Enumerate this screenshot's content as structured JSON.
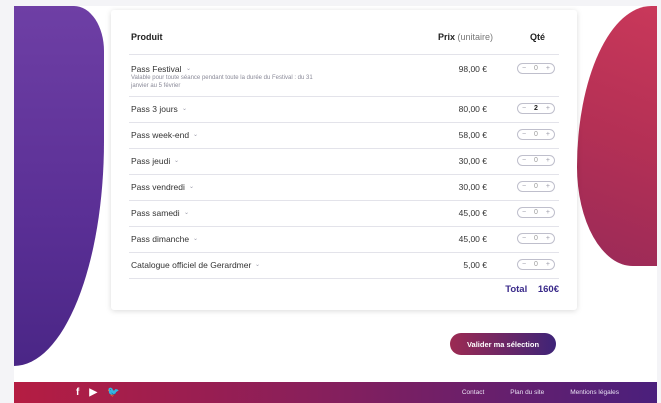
{
  "table": {
    "header_product": "Produit",
    "header_price": "Prix",
    "header_price_unit": "(unitaire)",
    "header_qty": "Qté"
  },
  "rows": [
    {
      "name": "Pass Festival",
      "desc": "Valable pour toute séance pendant toute la durée du Festival : du 31 janvier au 5 février",
      "price": "98,00 €",
      "qty": "0"
    },
    {
      "name": "Pass 3 jours",
      "price": "80,00 €",
      "qty": "2"
    },
    {
      "name": "Pass week-end",
      "price": "58,00 €",
      "qty": "0"
    },
    {
      "name": "Pass jeudi",
      "price": "30,00 €",
      "qty": "0"
    },
    {
      "name": "Pass vendredi",
      "price": "30,00 €",
      "qty": "0"
    },
    {
      "name": "Pass samedi",
      "price": "45,00 €",
      "qty": "0"
    },
    {
      "name": "Pass dimanche",
      "price": "45,00 €",
      "qty": "0"
    },
    {
      "name": "Catalogue officiel de Gerardmer",
      "price": "5,00 €",
      "qty": "0"
    }
  ],
  "stepper": {
    "minus": "−",
    "plus": "+"
  },
  "total": {
    "label": "Total",
    "value": "160€"
  },
  "validate_label": "Valider ma sélection",
  "footer": {
    "social": [
      {
        "icon": "facebook-icon",
        "glyph": "f"
      },
      {
        "icon": "youtube-icon",
        "glyph": "▶"
      },
      {
        "icon": "twitter-icon",
        "glyph": "🐦"
      }
    ],
    "links": [
      "Contact",
      "Plan du site",
      "Mentions légales"
    ]
  },
  "colors": {
    "accent": "#3a2a8a",
    "brand_red": "#b51d42",
    "brand_purple": "#4a1f7c"
  }
}
